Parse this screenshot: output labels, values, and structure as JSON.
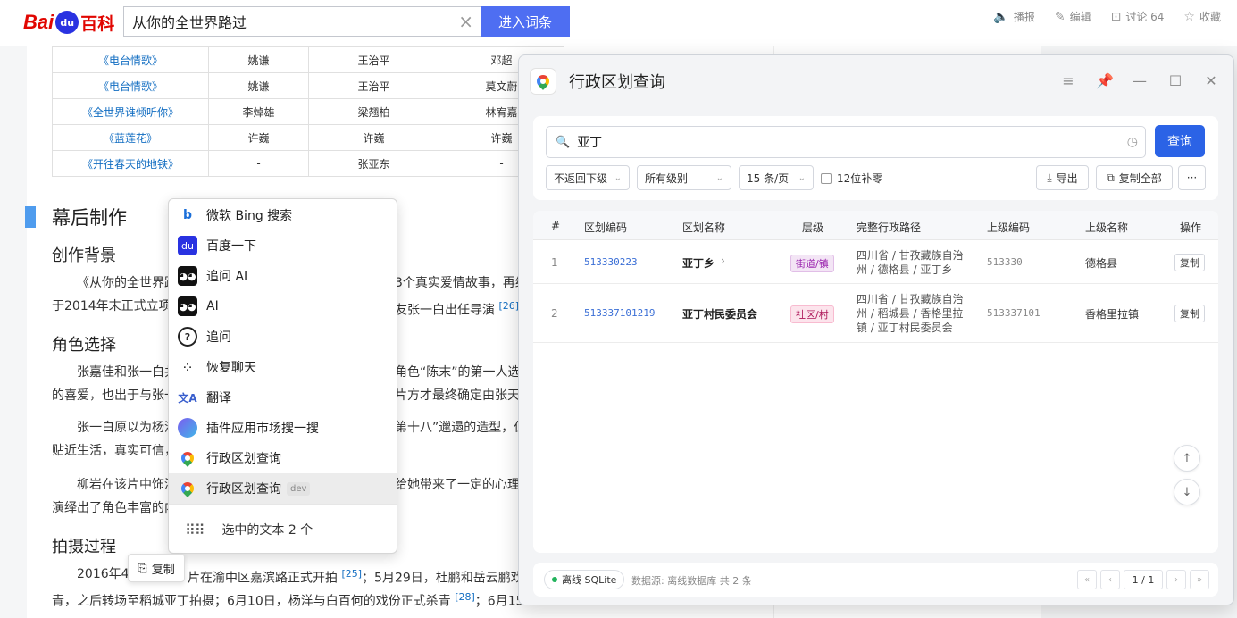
{
  "baike": {
    "logo_bai": "Bai",
    "logo_du": "du",
    "logo_baike": "百科",
    "search_value": "从你的全世界路过",
    "enter_button": "进入词条",
    "actions": [
      {
        "icon": "speaker-icon",
        "label": "播报"
      },
      {
        "icon": "edit-icon",
        "label": "编辑"
      },
      {
        "icon": "comment-icon",
        "label": "讨论 64"
      },
      {
        "icon": "star-icon",
        "label": "收藏"
      }
    ]
  },
  "film_table": [
    [
      "《电台情歌》",
      "姚谦",
      "王治平",
      "邓超"
    ],
    [
      "《电台情歌》",
      "姚谦",
      "王治平",
      "莫文蔚"
    ],
    [
      "《全世界谁倾听你》",
      "李焯雄",
      "梁翘柏",
      "林宥嘉"
    ],
    [
      "《蓝莲花》",
      "许巍",
      "许巍",
      "许巍"
    ],
    [
      "《开往春天的地铁》",
      "-",
      "张亚东",
      "-"
    ]
  ],
  "article": {
    "section_title": "幕后制作",
    "h_bg": "创作背景",
    "p_bg": "《从你的全世界路",
    "p_bg_r": "3个真实爱情故事，再经",
    "p_bg2": "于2014年末正式立项",
    "p_bg2_r": "友张一白出任导演",
    "ref26": "[26]",
    "h_role": "角色选择",
    "p_role1": "张嘉佳和张一白共",
    "p_role1_r": "角色“陈末”的第一人选",
    "p_role2": "的喜爱，也出于与张一",
    "p_role2_r": "片方才最终确定由张天",
    "p_zhang1": "张一白原以为杨洋",
    "p_zhang1_r": "第十八”邋遢的造型，但",
    "p_zhang2": "贴近生活，真实可信，",
    "p_liu1": "柳岩在该片中饰演",
    "p_liu1_r": "给她带来了一定的心理",
    "p_liu2": "演绎出了角色丰富的内",
    "h_shoot": "拍摄过程",
    "p_shoot1": "2016年4月",
    "p_shoot1_m": "片在渝中区嘉滨路正式开拍",
    "ref25": "[25]",
    "p_shoot1_r": "；5月29日，杜鹏和岳云鹏戏",
    "p_shoot2": "青，之后转场至稻城亚丁拍摄；6月10日，杨洋与白百何的戏份正式杀青",
    "ref28": "[28]",
    "p_shoot2_r": "；6月15"
  },
  "context_menu": {
    "items": [
      {
        "icon": "bing-icon",
        "label": "微软 Bing 搜索"
      },
      {
        "icon": "baidu-paw-icon",
        "label": "百度一下"
      },
      {
        "icon": "ai-robot-icon",
        "label": "追问 AI"
      },
      {
        "icon": "ai-robot-icon",
        "label": "AI"
      },
      {
        "icon": "followup-question-icon",
        "label": "追问"
      },
      {
        "icon": "restore-chat-icon",
        "label": "恢复聊天"
      },
      {
        "icon": "translate-icon",
        "label": "翻译"
      },
      {
        "icon": "plugin-market-icon",
        "label": "插件应用市场搜一搜"
      },
      {
        "icon": "map-pin-icon",
        "label": "行政区划查询"
      },
      {
        "icon": "map-pin-icon",
        "label": "行政区划查询",
        "tag": "dev"
      }
    ],
    "footer": "选中的文本 2 个",
    "copy_label": "复制"
  },
  "panel": {
    "title": "行政区划查询",
    "query_value": "亚丁",
    "query_button": "查询",
    "filters": {
      "children": "不返回下级",
      "level": "所有级别",
      "page_size": "15 条/页",
      "pad_label": "12位补零"
    },
    "export_label": "导出",
    "copy_all_label": "复制全部",
    "columns": [
      "#",
      "区划编码",
      "区划名称",
      "层级",
      "完整行政路径",
      "上级编码",
      "上级名称",
      "操作"
    ],
    "rows": [
      {
        "idx": "1",
        "code": "513330223",
        "name": "亚丁乡",
        "level": "街道/镇",
        "path": "四川省 / 甘孜藏族自治州 / 德格县 / 亚丁乡",
        "parent_code": "513330",
        "parent_name": "德格县",
        "action": "复制"
      },
      {
        "idx": "2",
        "code": "513337101219",
        "name": "亚丁村民委员会",
        "level": "社区/村",
        "path": "四川省 / 甘孜藏族自治州 / 稻城县 / 香格里拉镇 / 亚丁村民委员会",
        "parent_code": "513337101",
        "parent_name": "香格里拉镇",
        "action": "复制"
      }
    ],
    "status_badge": "离线 SQLite",
    "source_text": "数据源: 离线数据库   共 2 条",
    "page_indicator": "1 / 1"
  }
}
